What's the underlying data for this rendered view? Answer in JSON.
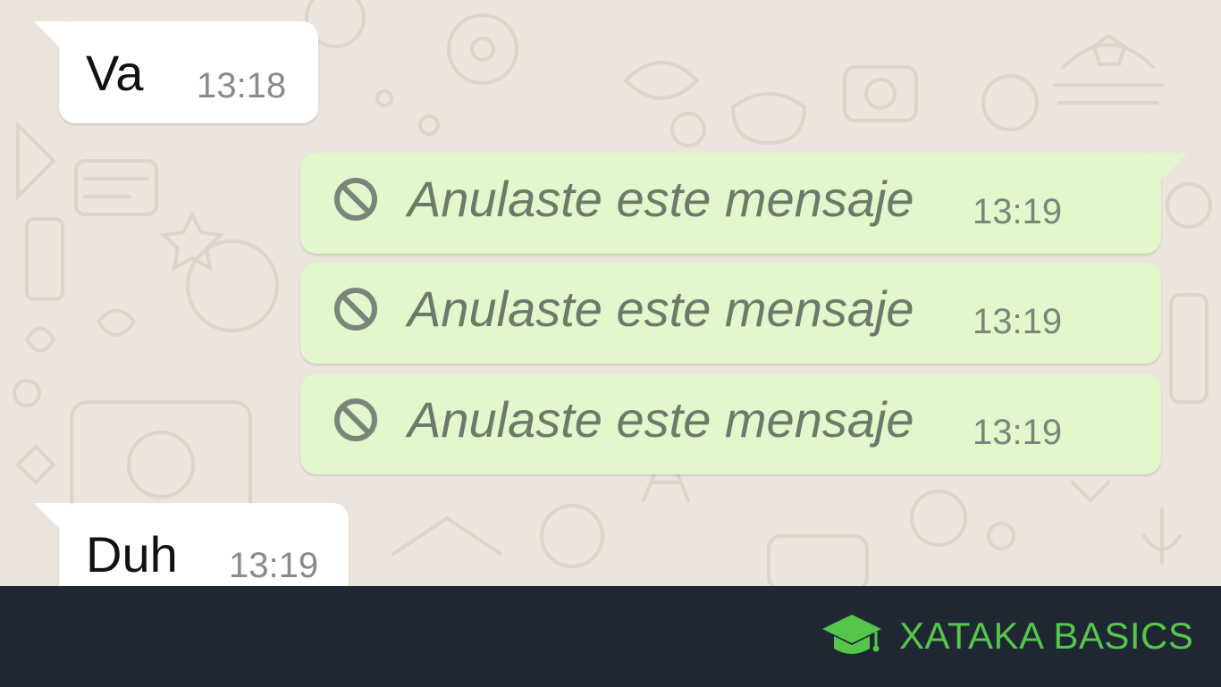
{
  "messages": [
    {
      "direction": "incoming",
      "text": "Va",
      "time": "13:18"
    },
    {
      "direction": "outgoing",
      "text": "Anulaste este mensaje",
      "time": "13:19",
      "deleted": true
    },
    {
      "direction": "outgoing",
      "text": "Anulaste este mensaje",
      "time": "13:19",
      "deleted": true
    },
    {
      "direction": "outgoing",
      "text": "Anulaste este mensaje",
      "time": "13:19",
      "deleted": true
    },
    {
      "direction": "incoming",
      "text": "Duh",
      "time": "13:19"
    }
  ],
  "icons": {
    "deleted": "ban-icon",
    "brand": "graduation-cap-icon"
  },
  "footer": {
    "brand_text": "XATAKA BASICS"
  },
  "colors": {
    "chat_background": "#ece5dd",
    "incoming_bubble": "#ffffff",
    "outgoing_bubble": "#e2f7cb",
    "footer_background": "#1f2733",
    "brand_green": "#55c64b"
  }
}
